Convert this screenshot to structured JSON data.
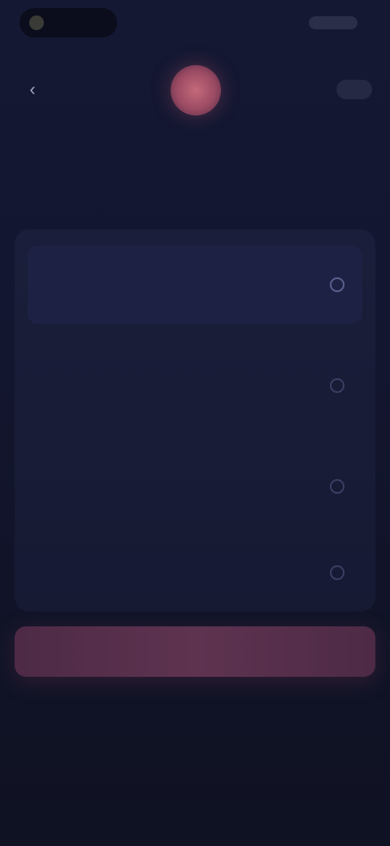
{
  "status_bar": {
    "time": "",
    "right_label": ""
  },
  "nav": {
    "back_icon": "arrow-left-icon",
    "back_glyph": "‹",
    "skip_label": ""
  },
  "header": {
    "step_label": "",
    "question": ""
  },
  "options": [
    {
      "text": "",
      "selected": true
    },
    {
      "text": "",
      "selected": false
    },
    {
      "text": "",
      "selected": false
    },
    {
      "text": "",
      "selected": false
    }
  ],
  "continue_label": "",
  "colors": {
    "accent": "#c0566a",
    "background": "#0f1222",
    "card": "#1a1e3a",
    "button": "#5e3350"
  }
}
